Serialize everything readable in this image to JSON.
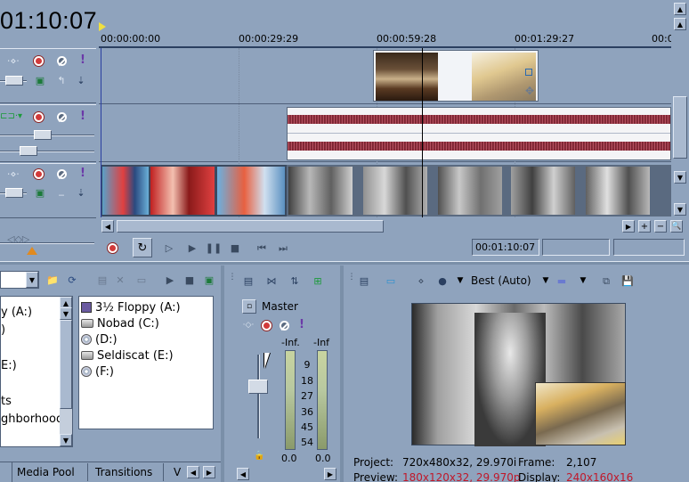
{
  "timecode": "01:10:07",
  "ruler": {
    "labels": [
      "00:00:00:00",
      "00:00:29:29",
      "00:00:59:28",
      "00:01:29:27",
      "00:01"
    ]
  },
  "transport": {
    "time_display": "00:01:10:07"
  },
  "explorer": {
    "left_items": [
      "y (A:)",
      ")",
      "E:)",
      "ts",
      "ghborhood"
    ],
    "drives": [
      {
        "label": "3½ Floppy (A:)",
        "icon": "floppy-icon"
      },
      {
        "label": "Nobad (C:)",
        "icon": "hard-drive-icon"
      },
      {
        "label": "(D:)",
        "icon": "cd-drive-icon"
      },
      {
        "label": "Seldiscat (E:)",
        "icon": "hard-drive-icon"
      },
      {
        "label": "(F:)",
        "icon": "cd-drive-icon"
      }
    ]
  },
  "tabs": [
    "Media Pool",
    "Transitions",
    "V"
  ],
  "mixer": {
    "title": "Master",
    "left_peak": "-Inf.",
    "right_peak": "-Inf",
    "scale": [
      "9",
      "18",
      "27",
      "36",
      "45",
      "54"
    ],
    "left_value": "0.0",
    "right_value": "0.0"
  },
  "preview": {
    "quality": "Best (Auto)",
    "project_label": "Project:",
    "project_value": "720x480x32, 29.970i",
    "frame_label": "Frame:",
    "frame_value": "2,107",
    "preview_label": "Preview:",
    "preview_value": "180x120x32, 29.970p",
    "display_label": "Display:",
    "display_value": "240x160x16"
  },
  "colors": {
    "background": "#8fa3bd",
    "accent_red": "#c0182a",
    "waveform": "#8a2e3a"
  }
}
